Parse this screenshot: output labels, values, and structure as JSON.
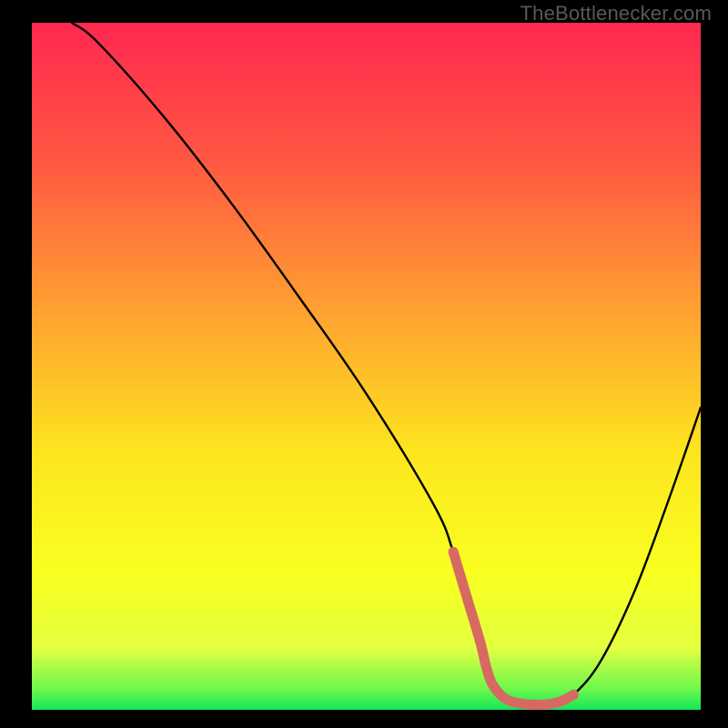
{
  "watermark": "TheBottlenecker.com",
  "chart_data": {
    "type": "line",
    "title": "",
    "xlabel": "",
    "ylabel": "",
    "xlim": [
      0,
      100
    ],
    "ylim": [
      0,
      100
    ],
    "series": [
      {
        "name": "curve",
        "color": "#000000",
        "x": [
          6,
          10,
          20,
          30,
          40,
          50,
          60,
          63,
          65,
          67,
          68,
          69,
          71,
          74,
          77,
          79,
          81,
          85,
          90,
          95,
          100
        ],
        "y": [
          100,
          97,
          86,
          73.5,
          60,
          46,
          30,
          23,
          16.5,
          10,
          6,
          3.5,
          1.5,
          0.8,
          0.8,
          1.2,
          2.2,
          7,
          17,
          30,
          44
        ]
      }
    ],
    "highlight": {
      "name": "trough-marker",
      "color": "#D66A63",
      "x": [
        63,
        65,
        67,
        68,
        69,
        71,
        74,
        77,
        79,
        81
      ],
      "y": [
        23,
        16.5,
        10,
        6,
        3.5,
        1.5,
        0.8,
        0.8,
        1.2,
        2.2
      ]
    },
    "gradient_stops": [
      {
        "offset": 0.0,
        "color": "#FF2850"
      },
      {
        "offset": 0.2,
        "color": "#FF5742"
      },
      {
        "offset": 0.43,
        "color": "#FFA530"
      },
      {
        "offset": 0.63,
        "color": "#FDE61E"
      },
      {
        "offset": 0.8,
        "color": "#F9FF20"
      },
      {
        "offset": 0.91,
        "color": "#E3FF40"
      },
      {
        "offset": 0.97,
        "color": "#6CF84D"
      },
      {
        "offset": 1.0,
        "color": "#15E758"
      }
    ]
  }
}
